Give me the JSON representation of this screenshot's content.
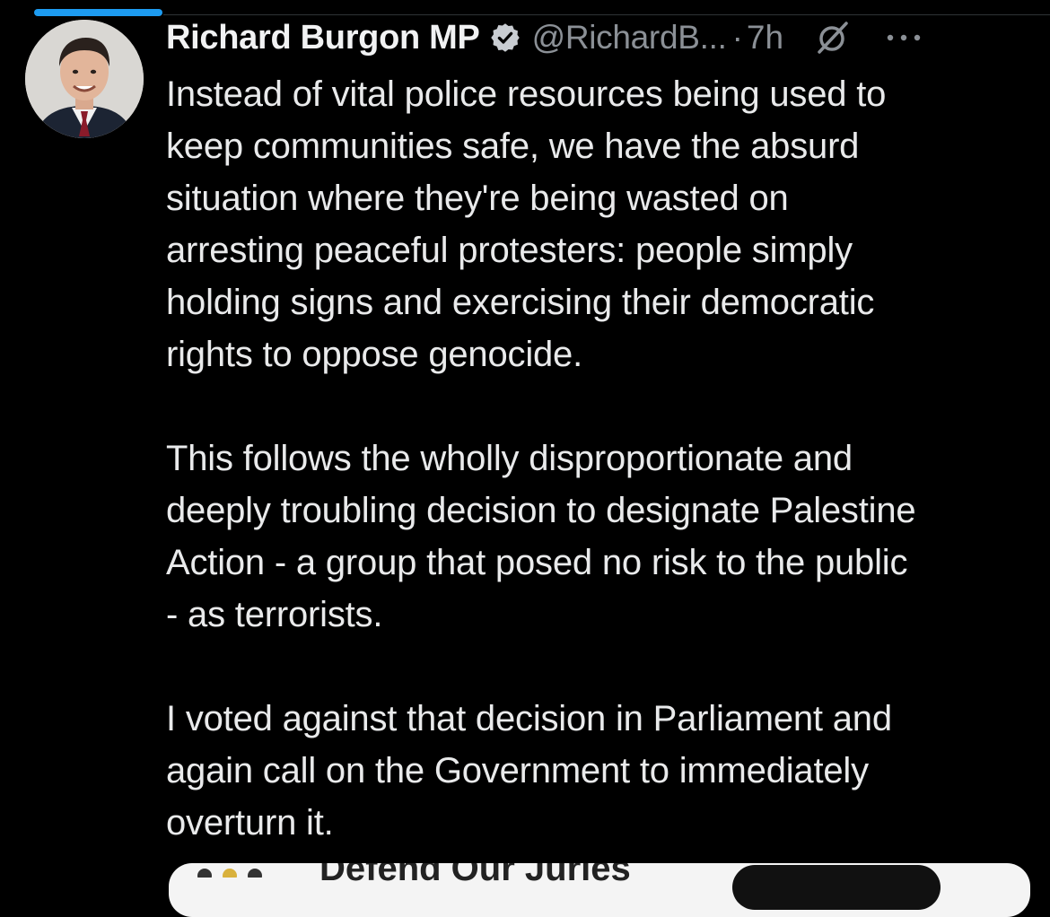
{
  "tweet": {
    "author": {
      "display_name": "Richard Burgon MP",
      "handle": "@RichardB...",
      "verified": true
    },
    "separator": "·",
    "timestamp": "7h",
    "paragraphs": [
      "Instead of vital police resources being used to\nkeep communities safe, we have the absurd\nsituation where they're being wasted on\narresting peaceful protesters: people simply\nholding signs and exercising their democratic\nrights to oppose genocide.",
      "This follows the wholly disproportionate and\ndeeply troubling decision to designate Palestine\nAction - a group that posed no risk to the public\n- as terrorists.",
      "I voted against that decision in Parliament and\nagain call on the Government to immediately\noverturn it."
    ]
  },
  "embed": {
    "partial_title": "Defend Our Juries"
  },
  "colors": {
    "background": "#000000",
    "text": "#e7e9ea",
    "muted": "#8b9096",
    "accent": "#1d9bf0"
  },
  "icons": {
    "verified": "verified-badge-icon",
    "grok": "grok-icon",
    "more": "more-options-icon"
  }
}
